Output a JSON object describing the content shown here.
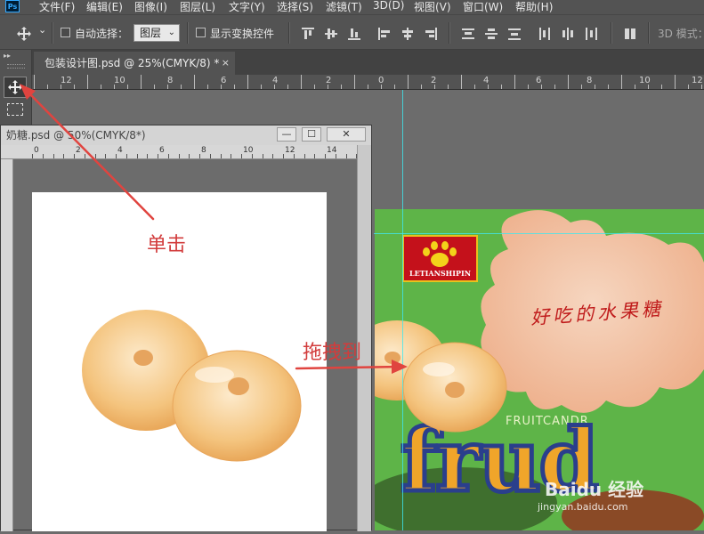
{
  "menu": [
    "文件(F)",
    "编辑(E)",
    "图像(I)",
    "图层(L)",
    "文字(Y)",
    "选择(S)",
    "滤镜(T)",
    "3D(D)",
    "视图(V)",
    "窗口(W)",
    "帮助(H)"
  ],
  "app_logo": "Ps",
  "options": {
    "auto_select_label": "自动选择：",
    "auto_select_value": "图层",
    "show_transform_label": "显示变换控件",
    "mode_3d_label": "3D 模式："
  },
  "tab": {
    "title": "包装设计图.psd @ 25%(CMYK/8) *",
    "close": "×"
  },
  "main_ruler_labels": [
    "12",
    "10",
    "8",
    "6",
    "4",
    "2",
    "0",
    "2",
    "4",
    "6",
    "8",
    "10",
    "12"
  ],
  "float_window": {
    "title": "奶糖.psd @ 50%(CMYK/8*)",
    "btn_min": "—",
    "btn_max": "☐",
    "btn_close": "✕",
    "ruler_labels": [
      "0",
      "2",
      "4",
      "6",
      "8",
      "10",
      "12",
      "14"
    ]
  },
  "design": {
    "logo_text": "LETIANSHIPIN",
    "slogan": "好吃的水果糖",
    "subtitle": "FRUITCANDR",
    "brand_text": "frud",
    "watermark": "Baidu 经验",
    "watermark_url": "jingyan.baidu.com"
  },
  "annotations": {
    "click": "单击",
    "drag": "拖拽到"
  },
  "colors": {
    "annotation": "#d23c3c",
    "guide": "#3fe7ef",
    "package_green": "#5eb448",
    "candy": "#f2c27a"
  },
  "icons": {
    "move_tool": "move-arrows-icon",
    "marquee_tool": "rect-marquee-icon"
  }
}
